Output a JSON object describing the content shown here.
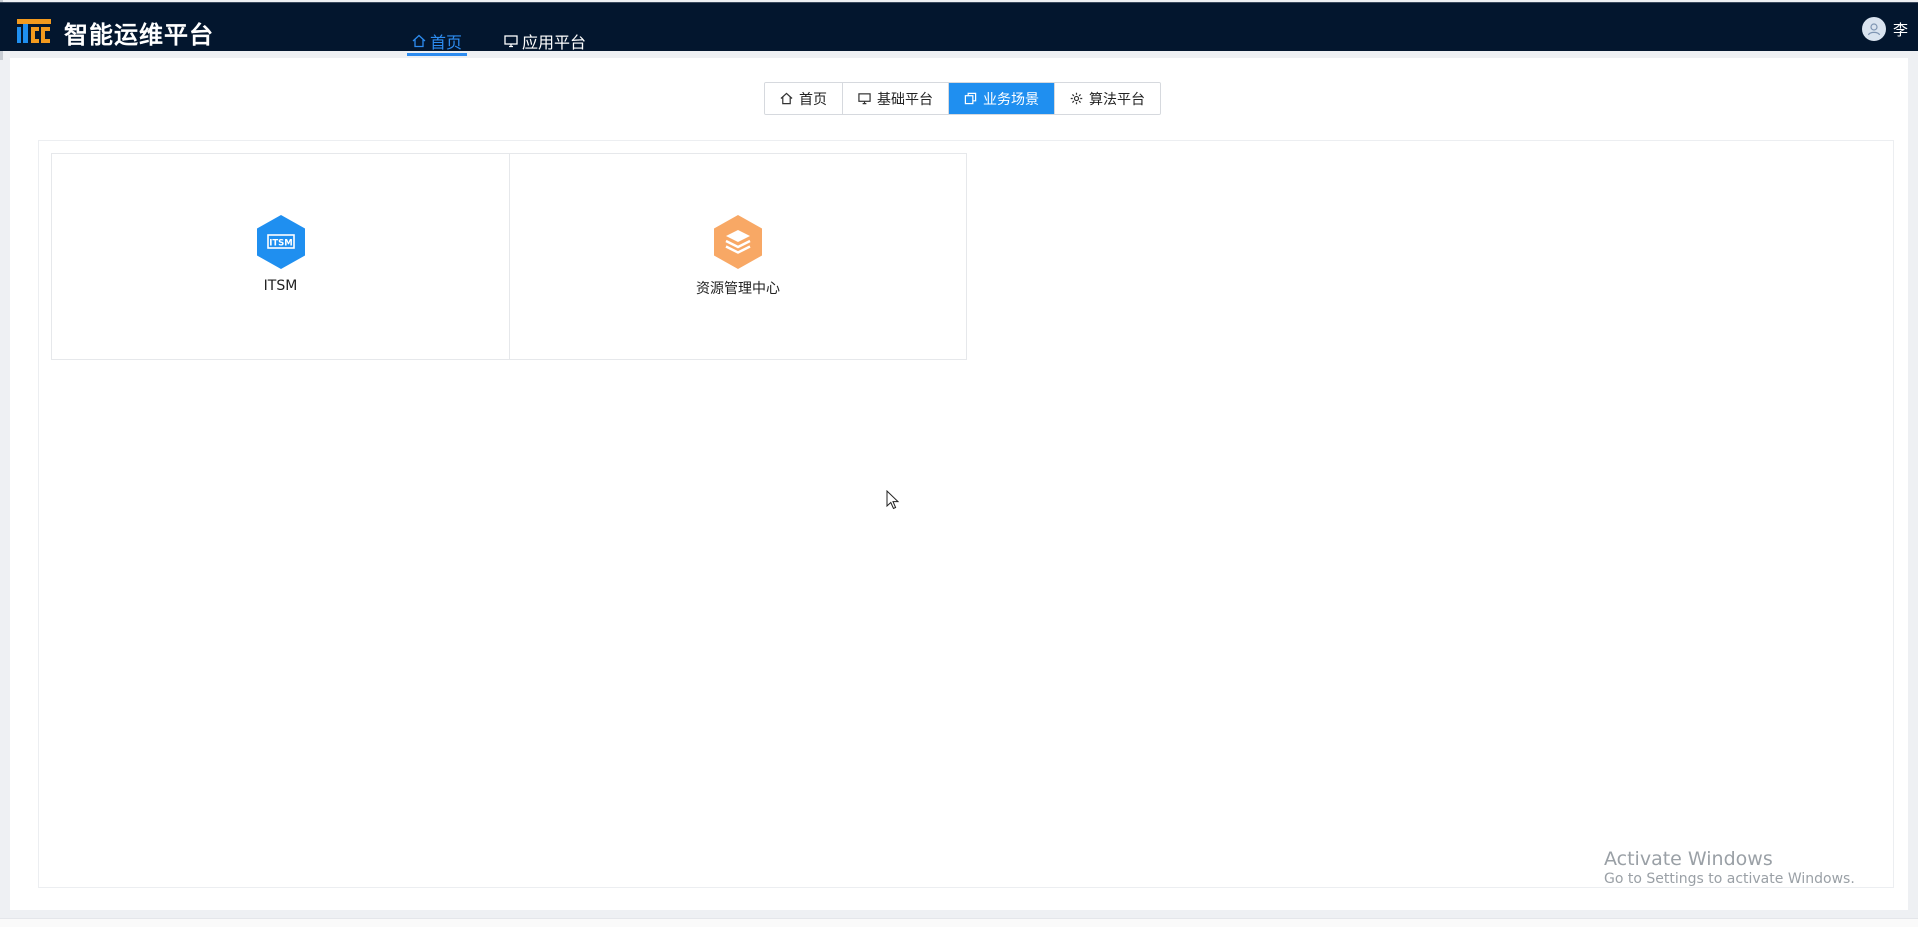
{
  "header": {
    "logo_text": "ITCC",
    "title": "智能运维平台",
    "nav": [
      {
        "label": "首页",
        "icon": "home-icon",
        "active": true
      },
      {
        "label": "应用平台",
        "icon": "monitor-icon",
        "active": false
      }
    ],
    "user_name": "李"
  },
  "segments": [
    {
      "label": "首页",
      "icon": "home-icon",
      "active": false
    },
    {
      "label": "基础平台",
      "icon": "monitor-icon",
      "active": false
    },
    {
      "label": "业务场景",
      "icon": "copy-icon",
      "active": true
    },
    {
      "label": "算法平台",
      "icon": "gear-icon",
      "active": false
    }
  ],
  "cards": [
    {
      "label": "ITSM",
      "badge": "ITSM",
      "icon": "itsm-hexagon-icon",
      "color": "#1f8ff0"
    },
    {
      "label": "资源管理中心",
      "icon": "layers-hexagon-icon",
      "color": "#f8a865"
    }
  ],
  "watermark": {
    "line1": "Activate Windows",
    "line2": "Go to Settings to activate Windows."
  },
  "colors": {
    "header_bg": "#03162e",
    "accent": "#1f8ff0",
    "orange": "#f8a865"
  }
}
